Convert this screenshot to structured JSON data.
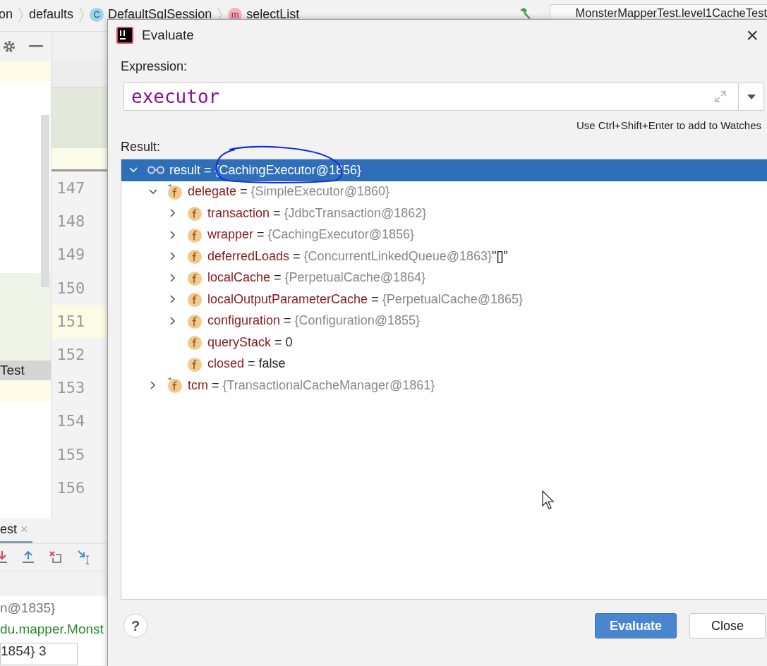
{
  "breadcrumbs": [
    {
      "label": "on",
      "kind": "text"
    },
    {
      "label": "defaults",
      "kind": "text"
    },
    {
      "label": "DefaultSqlSession",
      "kind": "class",
      "badge": "C"
    },
    {
      "label": "selectList",
      "kind": "method",
      "badge": "m"
    }
  ],
  "run_config": "MonsterMapperTest.level1CacheTest",
  "side_panel": {
    "item": "Test"
  },
  "editor": {
    "lines": [
      {
        "number": "147",
        "current": false
      },
      {
        "number": "148",
        "current": false
      },
      {
        "number": "149",
        "current": false
      },
      {
        "number": "150",
        "current": false
      },
      {
        "number": "151",
        "current": true
      },
      {
        "number": "152",
        "current": false
      },
      {
        "number": "153",
        "current": false
      },
      {
        "number": "154",
        "current": false
      },
      {
        "number": "155",
        "current": false
      },
      {
        "number": "156",
        "current": false
      }
    ]
  },
  "bottom_panel": {
    "tab": {
      "label": "est",
      "close": "×",
      "selected": true
    },
    "console_lines": [
      {
        "text": "n@1835}",
        "kind": "muted"
      },
      {
        "text": "du.mapper.Monst",
        "kind": "path"
      },
      {
        "text": "1854} 3",
        "kind": "plain"
      }
    ]
  },
  "dialog": {
    "title": "Evaluate",
    "close": "×",
    "expression_label": "Expression:",
    "expression": "executor",
    "hint": "Use Ctrl+Shift+Enter to add to Watches",
    "result_label": "Result:",
    "result": [
      {
        "name": "result",
        "op": "=",
        "value": "{CachingExecutor@1856}",
        "kind": "watch",
        "muted": true,
        "selected": true,
        "expanded": true,
        "children": [
          {
            "name": "delegate",
            "op": "=",
            "value": "{SimpleExecutor@1860}",
            "kind": "field",
            "muted": true,
            "selected": false,
            "expanded": true,
            "children": [
              {
                "name": "transaction",
                "op": "=",
                "value": "{JdbcTransaction@1862}",
                "kind": "field",
                "muted": true,
                "selected": false,
                "expanded": false
              },
              {
                "name": "wrapper",
                "op": "=",
                "value": "{CachingExecutor@1856}",
                "kind": "field",
                "muted": true,
                "selected": false,
                "expanded": false
              },
              {
                "name": "deferredLoads",
                "op": "=",
                "value": "{ConcurrentLinkedQueue@1863}",
                "suffix": "\"[]\"",
                "kind": "field",
                "muted": true,
                "selected": false,
                "expanded": false
              },
              {
                "name": "localCache",
                "op": "=",
                "value": "{PerpetualCache@1864}",
                "kind": "field",
                "muted": true,
                "selected": false,
                "expanded": false
              },
              {
                "name": "localOutputParameterCache",
                "op": "=",
                "value": "{PerpetualCache@1865}",
                "kind": "field",
                "muted": true,
                "selected": false,
                "expanded": false
              },
              {
                "name": "configuration",
                "op": "=",
                "value": "{Configuration@1855}",
                "kind": "field",
                "muted": true,
                "selected": false,
                "expanded": false
              },
              {
                "name": "queryStack",
                "op": "=",
                "value": "0",
                "kind": "leaf",
                "muted": false,
                "selected": false
              },
              {
                "name": "closed",
                "op": "=",
                "value": "false",
                "kind": "leaf",
                "muted": false,
                "selected": false
              }
            ]
          },
          {
            "name": "tcm",
            "op": "=",
            "value": "{TransactionalCacheManager@1861}",
            "kind": "field",
            "muted": true,
            "selected": false,
            "expanded": false
          }
        ]
      }
    ],
    "help": "?",
    "buttons": [
      {
        "label": "Evaluate",
        "kind": "primary"
      },
      {
        "label": "Close",
        "kind": "default"
      }
    ]
  }
}
